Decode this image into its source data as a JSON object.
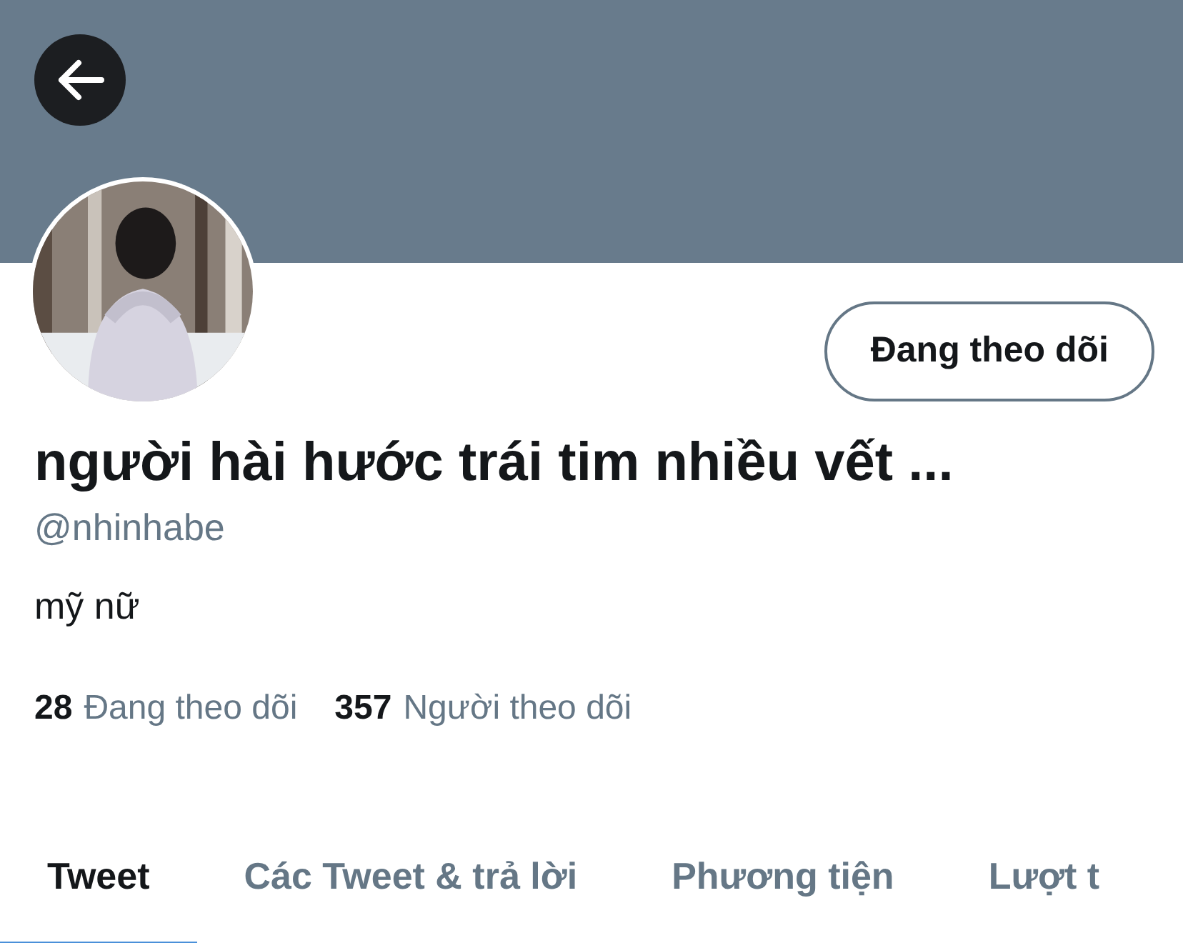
{
  "profile": {
    "name": "người hài hước trái tim nhiều vết ...",
    "handle": "@nhinhabe",
    "bio": "mỹ nữ",
    "follow_button": "Đang theo dõi",
    "stats": [
      {
        "count": "28",
        "label": "Đang theo dõi"
      },
      {
        "count": "357",
        "label": "Người theo dõi"
      }
    ]
  },
  "tabs": [
    {
      "label": "Tweet",
      "selected": true
    },
    {
      "label": "Các Tweet & trả lời",
      "selected": false
    },
    {
      "label": "Phương tiện",
      "selected": false
    },
    {
      "label": "Lượt t",
      "selected": false
    }
  ]
}
